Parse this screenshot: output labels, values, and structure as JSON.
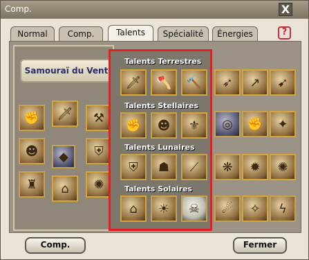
{
  "window": {
    "title": "Comp.",
    "close_label": "X"
  },
  "tabs": [
    {
      "label": "Normal",
      "active": false
    },
    {
      "label": "Comp.",
      "active": false
    },
    {
      "label": "Talents",
      "active": true
    },
    {
      "label": "Spécialité",
      "active": false
    },
    {
      "label": "Énergies",
      "active": false
    }
  ],
  "help": {
    "label": "?"
  },
  "class_tree": {
    "name": "Samouraï du Vent"
  },
  "talent_groups": [
    {
      "title": "Talents Terrestres",
      "icons": [
        "blade-icon",
        "axe-icon",
        "hammer-icon"
      ]
    },
    {
      "title": "Talents Stellaires",
      "icons": [
        "fighter-icon",
        "warrior-icon",
        "gold-armor-icon"
      ]
    },
    {
      "title": "Talents Lunaires",
      "icons": [
        "shield-icon",
        "guard-icon",
        "claw-icon"
      ]
    },
    {
      "title": "Talents Solaires",
      "icons": [
        "temple-icon",
        "light-icon",
        "skull-icon"
      ]
    }
  ],
  "buttons": {
    "comp": "Comp.",
    "close": "Fermer"
  },
  "colors": {
    "highlight_border": "#e51d23",
    "help_accent": "#b8333c"
  }
}
